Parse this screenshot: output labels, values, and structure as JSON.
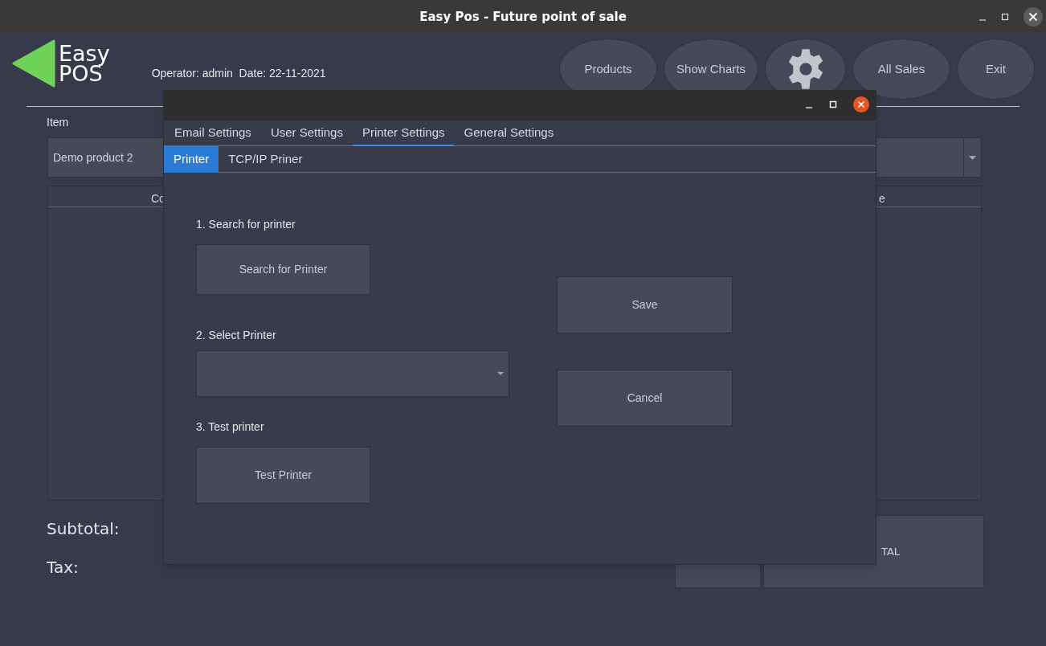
{
  "window": {
    "title": "Easy Pos - Future point of sale"
  },
  "logo": {
    "line_1": "Easy",
    "line_2": "POS"
  },
  "operator_info": "Operator: admin  Date: 22-11-2021",
  "nav_buttons": [
    {
      "kind": "text",
      "label": "Products"
    },
    {
      "kind": "text",
      "label": "Show Charts"
    },
    {
      "kind": "icon"
    },
    {
      "kind": "text",
      "label": "All Sales"
    },
    {
      "kind": "text",
      "label": "Exit"
    }
  ],
  "item_label": "Item",
  "item_select": {
    "value": "Demo product 2"
  },
  "table": {
    "columns": [
      "Co",
      "e"
    ]
  },
  "totals": [
    "Subtotal:",
    "Tax:"
  ],
  "total_button": {
    "label": "TAL"
  },
  "dialog": {
    "tabs": [
      {
        "label": "Email Settings",
        "selected": false
      },
      {
        "label": "User Settings",
        "selected": false
      },
      {
        "label": "Printer Settings",
        "selected": true
      },
      {
        "label": "General Settings",
        "selected": false
      }
    ],
    "subtabs": [
      {
        "label": "Printer",
        "selected": true
      },
      {
        "label": "TCP/IP Priner",
        "selected": false
      }
    ],
    "steps": [
      {
        "kind": "button",
        "label": "1. Search for printer",
        "button": "Search for Printer"
      },
      {
        "kind": "select",
        "label": "2. Select Printer"
      },
      {
        "kind": "button",
        "label": "3. Test printer",
        "button": "Test Printer"
      }
    ],
    "actions": [
      "Save",
      "Cancel"
    ]
  }
}
